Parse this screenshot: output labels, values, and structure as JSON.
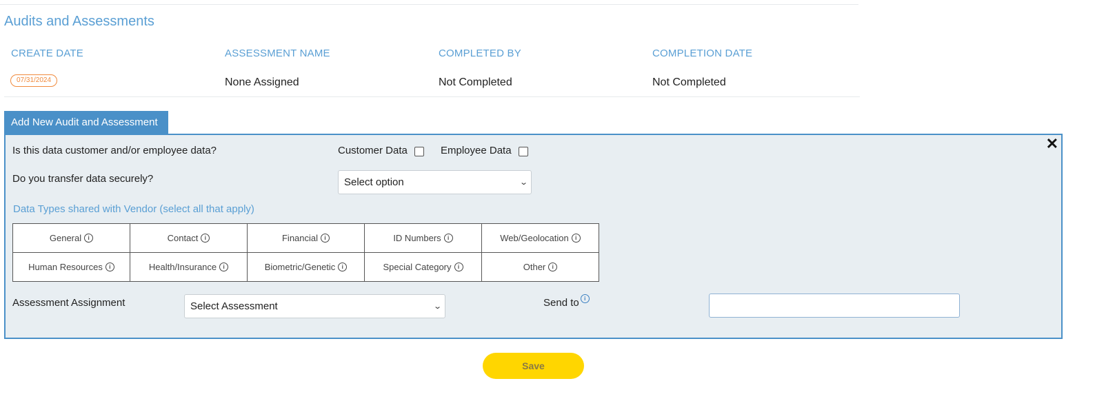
{
  "section": {
    "title": "Audits and Assessments"
  },
  "grid": {
    "headers": [
      "CREATE DATE",
      "ASSESSMENT NAME",
      "COMPLETED BY",
      "COMPLETION DATE"
    ],
    "rows": [
      {
        "create_date": "07/31/2024",
        "assessment_name": "None Assigned",
        "completed_by": "Not Completed",
        "completion_date": "Not Completed"
      }
    ]
  },
  "panel": {
    "tab_label": "Add New Audit and Assessment",
    "close_label": "✕",
    "q1": "Is this data customer and/or employee data?",
    "customer_data": "Customer Data",
    "employee_data": "Employee Data",
    "q2": "Do you transfer data securely?",
    "transfer_select": "Select option",
    "data_types_label": "Data Types shared with Vendor (select all that apply)",
    "data_types": [
      "General",
      "Contact",
      "Financial",
      "ID Numbers",
      "Web/Geolocation",
      "Human Resources",
      "Health/Insurance",
      "Biometric/Genetic",
      "Special Category",
      "Other"
    ],
    "assessment_label": "Assessment Assignment",
    "assessment_select": "Select Assessment",
    "send_to_label": "Send to",
    "send_to_value": ""
  },
  "actions": {
    "save_label": "Save"
  },
  "colors": {
    "accent": "#4a90c8",
    "save": "#ffd600",
    "badge": "#f08a3c"
  }
}
